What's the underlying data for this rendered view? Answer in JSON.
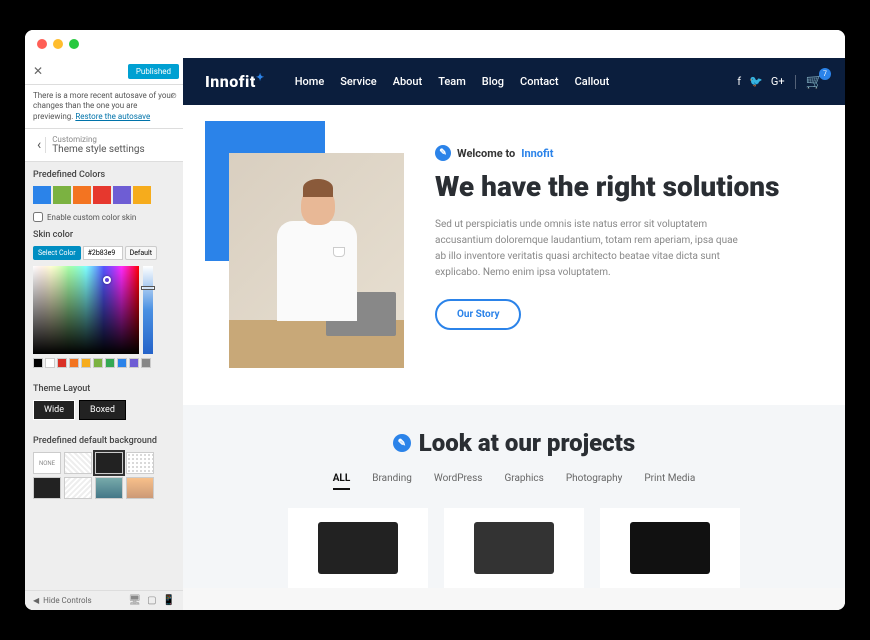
{
  "topbar": {
    "published": "Published"
  },
  "autosave": {
    "msg": "There is a more recent autosave of your changes than the one you are previewing.",
    "link": "Restore the autosave"
  },
  "customizing": {
    "label": "Customizing",
    "section": "Theme style settings"
  },
  "predefined": {
    "title": "Predefined Colors",
    "colors": [
      "#2b83e9",
      "#7bb241",
      "#f37421",
      "#e6382e",
      "#6e5dd4",
      "#f6ac1c"
    ]
  },
  "custom_skin": {
    "checkbox": "Enable custom color skin"
  },
  "skin": {
    "title": "Skin color",
    "select_btn": "Select Color",
    "hex": "#2b83e9",
    "default_btn": "Default",
    "palette": [
      "#000000",
      "#ffffff",
      "#d93025",
      "#f37421",
      "#f6ac1c",
      "#7bb241",
      "#34a853",
      "#2b83e9",
      "#6e5dd4",
      "#888888"
    ]
  },
  "layout": {
    "title": "Theme Layout",
    "wide": "Wide",
    "boxed": "Boxed"
  },
  "bg": {
    "title": "Predefined default background",
    "none": "NONE"
  },
  "footer": {
    "hide": "Hide Controls"
  },
  "nav": {
    "brand": "Innofit",
    "items": [
      "Home",
      "Service",
      "About",
      "Team",
      "Blog",
      "Contact",
      "Callout"
    ],
    "cart_count": "7"
  },
  "hero": {
    "welcome_pre": "Welcome to",
    "welcome_brand": "Innofit",
    "headline": "We have the right solutions",
    "para": "Sed ut perspiciatis unde omnis iste natus error sit voluptatem accusantium doloremque laudantium, totam rem aperiam, ipsa quae ab illo inventore veritatis quasi architecto beatae vitae dicta sunt explicabo. Nemo enim ipsa voluptatem.",
    "cta": "Our Story"
  },
  "projects": {
    "title": "Look at our projects",
    "filters": [
      "ALL",
      "Branding",
      "WordPress",
      "Graphics",
      "Photography",
      "Print Media"
    ]
  }
}
